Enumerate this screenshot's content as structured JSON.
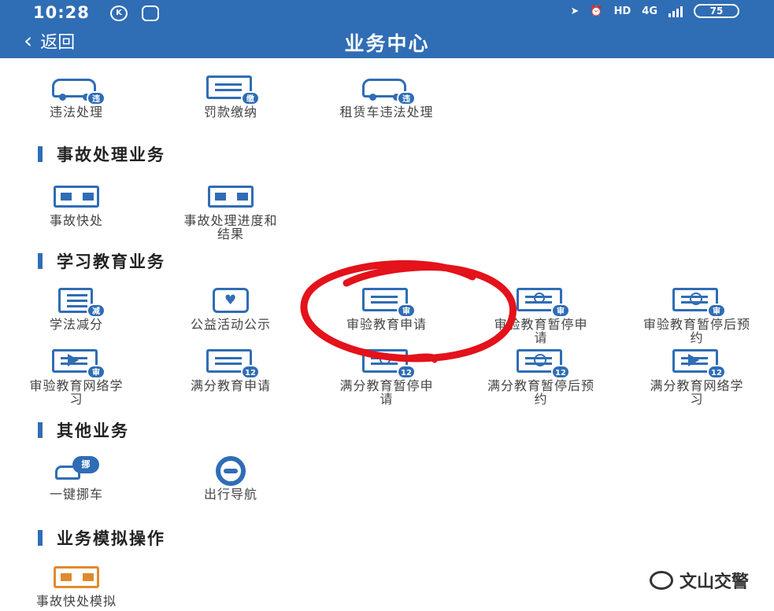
{
  "status_bar": {
    "time": "10:28",
    "k_icon": "K",
    "hd": "HD",
    "network": "4G",
    "battery": "75"
  },
  "nav": {
    "back_label": "返回",
    "title": "业务中心"
  },
  "top_row": [
    {
      "label": "违法处理",
      "icon": "car-violation-icon",
      "badge": "违"
    },
    {
      "label": "罚款缴纳",
      "icon": "fine-payment-icon",
      "badge": "缴"
    },
    {
      "label": "租赁车违法处理",
      "icon": "rental-car-icon",
      "badge": "违"
    }
  ],
  "sections": {
    "accident": {
      "title": "事故处理业务",
      "items": [
        {
          "label": "事故快处",
          "icon": "accident-quick-icon"
        },
        {
          "label": "事故处理进度和结果",
          "icon": "accident-progress-icon"
        }
      ]
    },
    "education": {
      "title": "学习教育业务",
      "items": [
        {
          "label": "学法减分",
          "icon": "study-law-icon",
          "badge": "减"
        },
        {
          "label": "公益活动公示",
          "icon": "charity-icon"
        },
        {
          "label": "审验教育申请",
          "icon": "review-edu-apply-icon",
          "badge": "审"
        },
        {
          "label": "审验教育暂停申请",
          "icon": "review-edu-pause-icon",
          "badge": "审"
        },
        {
          "label": "审验教育暂停后预约",
          "icon": "review-edu-appoint-icon",
          "badge": "审"
        },
        {
          "label": "审验教育网络学习",
          "icon": "review-edu-online-icon",
          "badge": "审"
        },
        {
          "label": "满分教育申请",
          "icon": "full-score-apply-icon",
          "badge": "12"
        },
        {
          "label": "满分教育暂停申请",
          "icon": "full-score-pause-icon",
          "badge": "12"
        },
        {
          "label": "满分教育暂停后预约",
          "icon": "full-score-appoint-icon",
          "badge": "12"
        },
        {
          "label": "满分教育网络学习",
          "icon": "full-score-online-icon",
          "badge": "12"
        }
      ]
    },
    "other": {
      "title": "其他业务",
      "items": [
        {
          "label": "一键挪车",
          "icon": "move-car-icon",
          "badge": "挪"
        },
        {
          "label": "出行导航",
          "icon": "navigation-wheel-icon"
        }
      ]
    },
    "simulation": {
      "title": "业务模拟操作",
      "items": [
        {
          "label": "事故快处模拟",
          "icon": "accident-sim-icon"
        }
      ]
    }
  },
  "watermark": {
    "text": "文山交警"
  },
  "colors": {
    "brand_blue": "#2f6db5",
    "annotation_red": "#e3121b",
    "sim_orange": "#e08a2e"
  }
}
